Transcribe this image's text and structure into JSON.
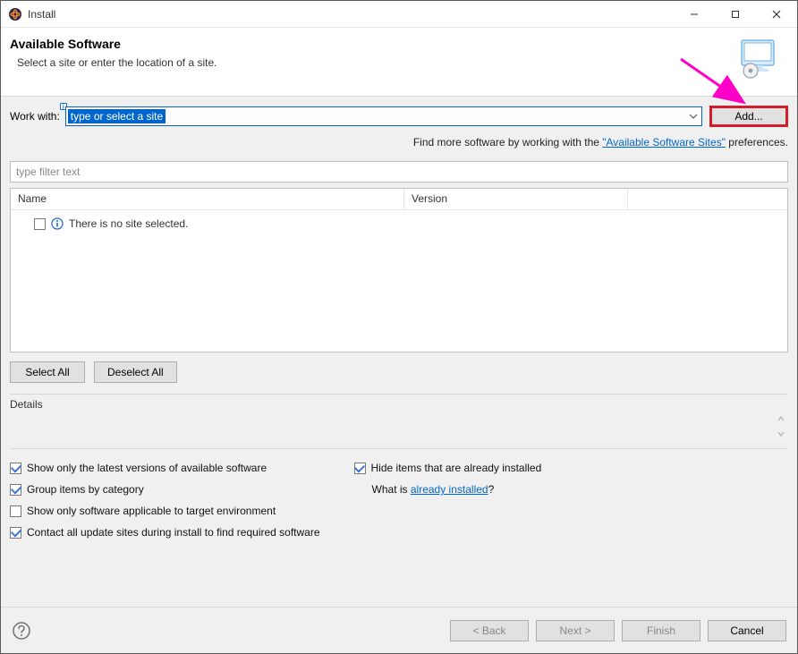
{
  "window": {
    "title": "Install"
  },
  "header": {
    "title": "Available Software",
    "subtitle": "Select a site or enter the location of a site."
  },
  "workwith": {
    "label": "Work with:",
    "selected_text": "type or select a site",
    "add_label": "Add..."
  },
  "hint": {
    "prefix": "Find more software by working with the ",
    "link": "\"Available Software Sites\"",
    "suffix": " preferences."
  },
  "filter": {
    "placeholder": "type filter text"
  },
  "tree": {
    "columns": {
      "name": "Name",
      "version": "Version"
    },
    "empty_row": "There is no site selected."
  },
  "buttons": {
    "select_all": "Select All",
    "deselect_all": "Deselect All"
  },
  "details": {
    "label": "Details"
  },
  "options": {
    "latest": {
      "checked": true,
      "label": "Show only the latest versions of available software"
    },
    "group": {
      "checked": true,
      "label": "Group items by category"
    },
    "target": {
      "checked": false,
      "label": "Show only software applicable to target environment"
    },
    "contact": {
      "checked": true,
      "label": "Contact all update sites during install to find required software"
    },
    "hide": {
      "checked": true,
      "label": "Hide items that are already installed"
    },
    "whatis_prefix": "What is ",
    "whatis_link": "already installed",
    "whatis_suffix": "?"
  },
  "footer": {
    "back": "< Back",
    "next": "Next >",
    "finish": "Finish",
    "cancel": "Cancel"
  }
}
